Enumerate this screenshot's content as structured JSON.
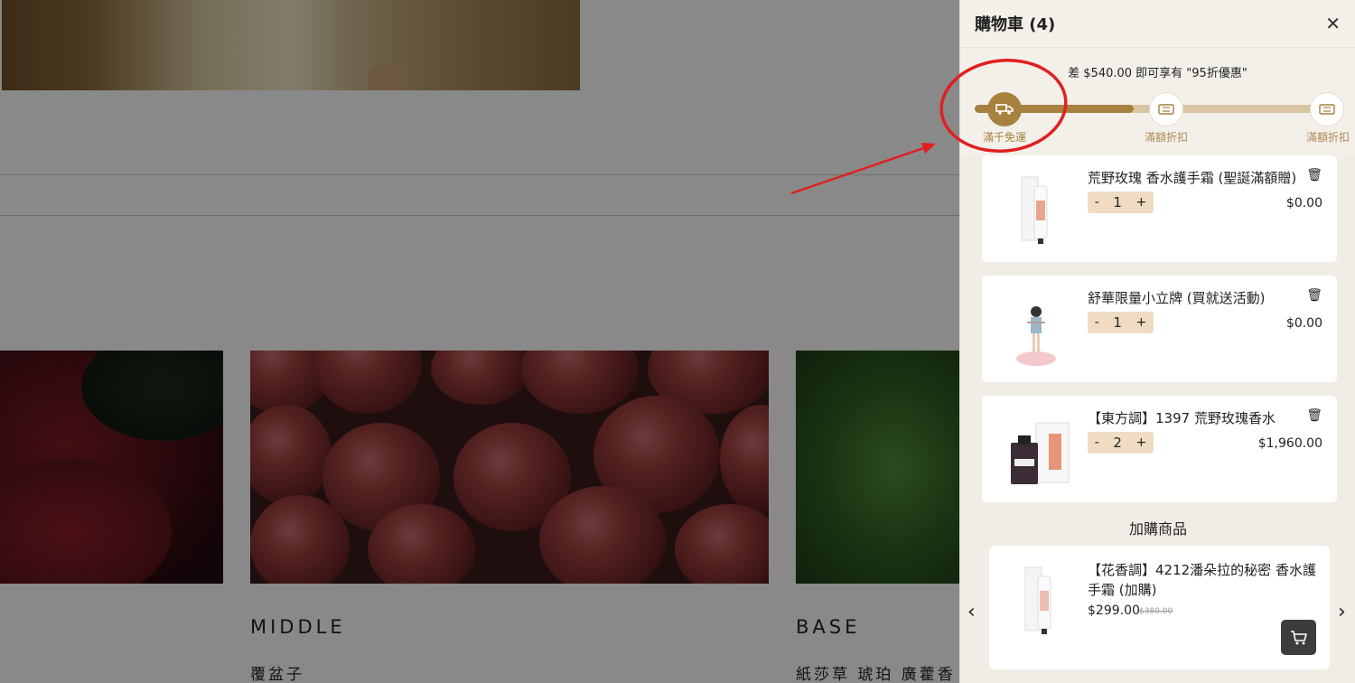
{
  "background": {
    "notes": [
      {
        "title": "MIDDLE",
        "desc": "覆盆子"
      },
      {
        "title": "BASE",
        "desc": "紙莎草 琥珀 廣藿香"
      }
    ]
  },
  "cart": {
    "title": "購物車 (4)",
    "close_icon": "close-icon",
    "promo_text": "差 $540.00 即可享有 \"95折優惠\"",
    "progress_fill_fraction": 0.45,
    "milestones": [
      {
        "label": "滿千免運",
        "icon": "truck-icon",
        "status": "done"
      },
      {
        "label": "滿額折扣",
        "icon": "coupon-icon",
        "status": "todo"
      },
      {
        "label": "滿額折扣",
        "icon": "coupon-icon",
        "status": "todo"
      }
    ],
    "items": [
      {
        "name": "荒野玫瑰 香水護手霜 (聖誕滿額贈)",
        "qty": "1",
        "price": "$0.00",
        "thumb": "hand-cream"
      },
      {
        "name": "舒華限量小立牌 (買就送活動)",
        "qty": "1",
        "price": "$0.00",
        "thumb": "standee"
      },
      {
        "name": "【東方調】1397 荒野玫瑰香水",
        "qty": "2",
        "price": "$1,960.00",
        "thumb": "perfume"
      }
    ],
    "qty_minus": "-",
    "qty_plus": "+",
    "addon": {
      "title": "加購商品",
      "name": "【花香調】4212潘朵拉的秘密 香水護手霜 (加購)",
      "price": "$299.00",
      "original_price": "$380.00"
    },
    "prev_icon": "chevron-left-icon",
    "next_icon": "chevron-right-icon",
    "colors": {
      "accent": "#a6813f",
      "track": "#d9c5a4",
      "annotation": "#e02020"
    }
  }
}
